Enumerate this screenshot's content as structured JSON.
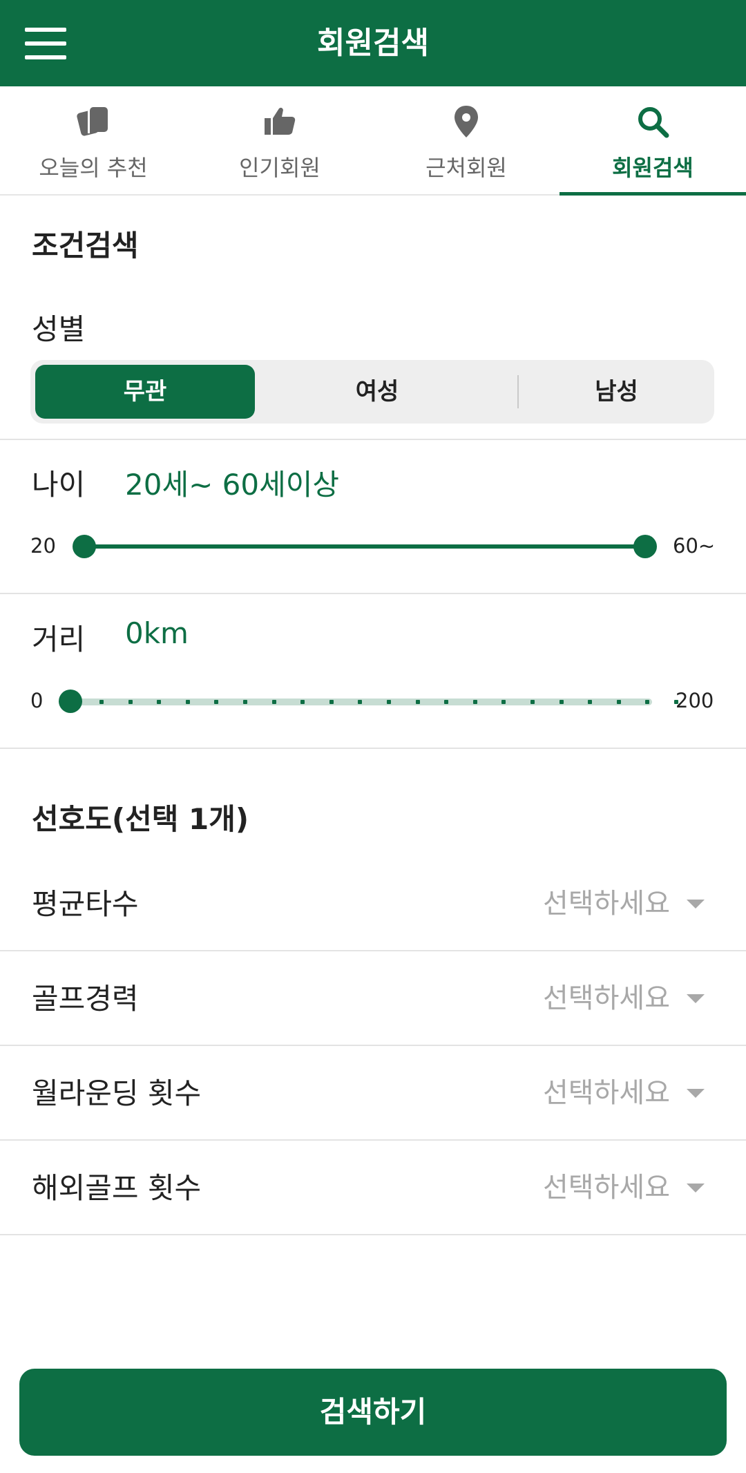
{
  "header": {
    "title": "회원검색",
    "menu_icon": "hamburger-menu-icon"
  },
  "tabs": [
    {
      "label": "오늘의 추천",
      "icon": "cards-icon",
      "active": false
    },
    {
      "label": "인기회원",
      "icon": "thumbs-up-icon",
      "active": false
    },
    {
      "label": "근처회원",
      "icon": "location-pin-icon",
      "active": false
    },
    {
      "label": "회원검색",
      "icon": "search-icon",
      "active": true
    }
  ],
  "condition_search": {
    "title": "조건검색",
    "gender": {
      "label": "성별",
      "options": [
        "무관",
        "여성",
        "남성"
      ],
      "selected": "무관"
    },
    "age": {
      "label": "나이",
      "value_text": "20세~ 60세이상",
      "min_label": "20",
      "max_label": "60~",
      "range_min": 20,
      "range_max": 60,
      "selected_low": 20,
      "selected_high": 60
    },
    "distance": {
      "label": "거리",
      "value_text": "0km",
      "min_label": "0",
      "max_label": "200",
      "range_min": 0,
      "range_max": 200,
      "selected": 0
    }
  },
  "preferences": {
    "title": "선호도(선택 1개)",
    "placeholder": "선택하세요",
    "items": [
      {
        "label": "평균타수"
      },
      {
        "label": "골프경력"
      },
      {
        "label": "월라운딩 횟수"
      },
      {
        "label": "해외골프 횟수"
      }
    ]
  },
  "search_button": {
    "label": "검색하기"
  },
  "colors": {
    "primary": "#0d6e44",
    "muted": "#a8a8a8",
    "track_light": "#c7ddd3"
  }
}
